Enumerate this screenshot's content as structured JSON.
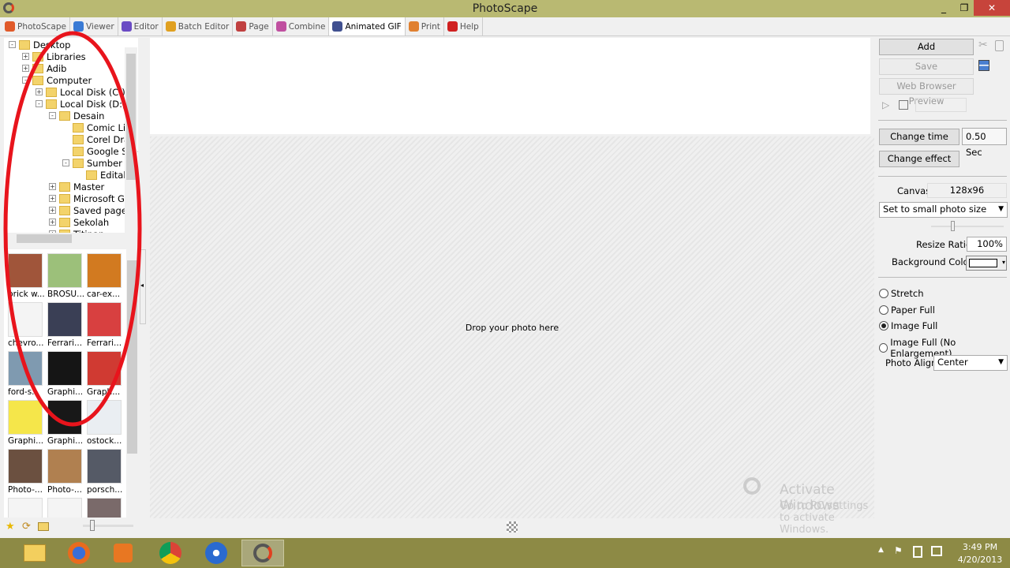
{
  "window": {
    "title": "PhotoScape",
    "controls": [
      "minimize",
      "restore",
      "close"
    ]
  },
  "tabs": [
    {
      "label": "PhotoScape",
      "color": "#e05a2a"
    },
    {
      "label": "Viewer",
      "color": "#3a7bd5"
    },
    {
      "label": "Editor",
      "color": "#6a4bc4"
    },
    {
      "label": "Batch Editor",
      "color": "#e0a020"
    },
    {
      "label": "Page",
      "color": "#c04040"
    },
    {
      "label": "Combine",
      "color": "#c050a0"
    },
    {
      "label": "Animated GIF",
      "color": "#405090",
      "active": true
    },
    {
      "label": "Print",
      "color": "#e08030"
    },
    {
      "label": "Help",
      "color": "#d02020"
    }
  ],
  "tree": [
    {
      "label": "Desktop",
      "level": 0,
      "exp": "-"
    },
    {
      "label": "Libraries",
      "level": 1,
      "exp": "+"
    },
    {
      "label": "Adib",
      "level": 1,
      "exp": "+"
    },
    {
      "label": "Computer",
      "level": 1,
      "exp": "-"
    },
    {
      "label": "Local Disk (C:)",
      "level": 2,
      "exp": "+"
    },
    {
      "label": "Local Disk (D:)",
      "level": 2,
      "exp": "-"
    },
    {
      "label": "Desain",
      "level": 3,
      "exp": "-"
    },
    {
      "label": "Comic Life",
      "level": 4,
      "exp": ""
    },
    {
      "label": "Corel Draw",
      "level": 4,
      "exp": ""
    },
    {
      "label": "Google Sketchup",
      "level": 4,
      "exp": ""
    },
    {
      "label": "Sumber",
      "level": 4,
      "exp": "-"
    },
    {
      "label": "Editable",
      "level": 5,
      "exp": ""
    },
    {
      "label": "Master",
      "level": 3,
      "exp": "+"
    },
    {
      "label": "Microsoft Games",
      "level": 3,
      "exp": "+"
    },
    {
      "label": "Saved pages",
      "level": 3,
      "exp": "+"
    },
    {
      "label": "Sekolah",
      "level": 3,
      "exp": "+"
    },
    {
      "label": "Titipan",
      "level": 3,
      "exp": "+"
    }
  ],
  "thumbnails": [
    {
      "label": "brick w...",
      "color": "#a0553a"
    },
    {
      "label": "BROSU...",
      "color": "#9cc07a"
    },
    {
      "label": "car-ex...",
      "color": "#d27a20"
    },
    {
      "label": "chevro...",
      "color": "#f4f4f4"
    },
    {
      "label": "Ferrari...",
      "color": "#3a3f55"
    },
    {
      "label": "Ferrari...",
      "color": "#d84040"
    },
    {
      "label": "ford-s...",
      "color": "#7f9ab0"
    },
    {
      "label": "Graphi...",
      "color": "#151515"
    },
    {
      "label": "Graph...",
      "color": "#d03a32"
    },
    {
      "label": "Graphi...",
      "color": "#f5e64a"
    },
    {
      "label": "Graphi...",
      "color": "#181818"
    },
    {
      "label": "ostock...",
      "color": "#eaeef2"
    },
    {
      "label": "Photo-...",
      "color": "#6b5040"
    },
    {
      "label": "Photo-...",
      "color": "#b08050"
    },
    {
      "label": "porsch...",
      "color": "#555a66"
    },
    {
      "label": "",
      "color": "#f4f4f4"
    },
    {
      "label": "",
      "color": "#f4f4f4"
    },
    {
      "label": "",
      "color": "#7a6a6a"
    }
  ],
  "left_toolbar": [
    "star-icon",
    "refresh-icon",
    "folder-search-icon"
  ],
  "canvas": {
    "drop_text": "Drop your photo here"
  },
  "right": {
    "add": "Add",
    "save": "Save",
    "web_preview": "Web Browser Preview",
    "change_time": "Change time",
    "time_value": "0.50 Sec",
    "change_effect": "Change effect",
    "canvas_label": "Canvas",
    "canvas_value": "128x96",
    "size_select": "Set to small photo size",
    "resize_label": "Resize Ratio",
    "resize_value": "100%",
    "bg_label": "Background Color",
    "bg_color": "#ffffff",
    "radios": [
      {
        "label": "Stretch",
        "checked": false
      },
      {
        "label": "Paper Full",
        "checked": false
      },
      {
        "label": "Image Full",
        "checked": true
      },
      {
        "label": "Image Full (No Enlargement)",
        "checked": false
      }
    ],
    "align_label": "Photo Align",
    "align_value": "Center"
  },
  "watermark": {
    "line1": "Activate Windows",
    "line2": "Go to PC settings to activate Windows."
  },
  "taskbar": {
    "apps": [
      "file-explorer",
      "firefox",
      "media-player",
      "chrome",
      "app",
      "photoscape"
    ],
    "time": "3:49 PM",
    "date": "4/20/2013"
  },
  "annotation_color": "#e8141c"
}
